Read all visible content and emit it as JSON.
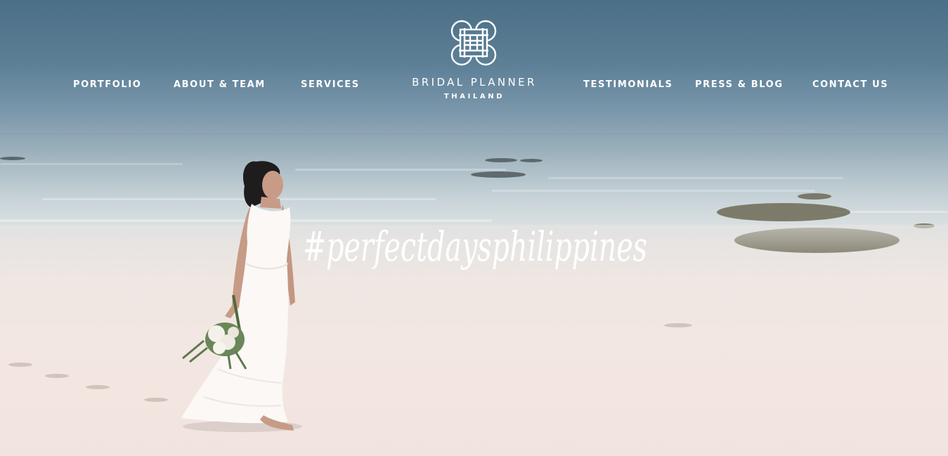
{
  "nav": {
    "left": [
      {
        "label": "PORTFOLIO"
      },
      {
        "label": "ABOUT & TEAM"
      },
      {
        "label": "SERVICES"
      }
    ],
    "right": [
      {
        "label": "TESTIMONIALS"
      },
      {
        "label": "PRESS & BLOG"
      },
      {
        "label": "CONTACT US"
      }
    ]
  },
  "logo": {
    "name": "BRIDAL PLANNER",
    "sub": "THAILAND",
    "icon": "knot-monogram-icon"
  },
  "hero": {
    "hashtag": "#perfectdaysphilippines",
    "colors": {
      "text": "#ffffff",
      "sky": "#4b6f86",
      "sand": "#f2e7e2"
    }
  }
}
